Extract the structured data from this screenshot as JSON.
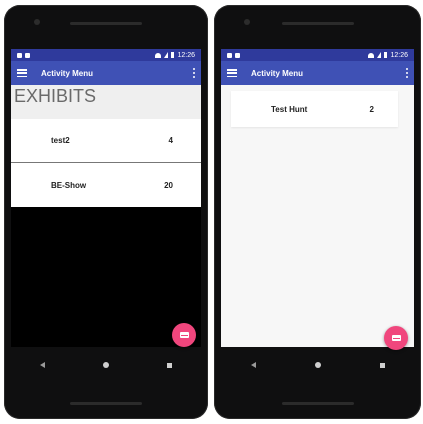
{
  "status": {
    "time": "12:26"
  },
  "left": {
    "appbar_title": "Activity Menu",
    "section_title": "EXHIBITS",
    "rows": [
      {
        "name": "test2",
        "count": "4"
      },
      {
        "name": "BE-Show",
        "count": "20"
      }
    ]
  },
  "right": {
    "appbar_title": "Activity Menu",
    "rows": [
      {
        "name": "Test Hunt",
        "count": "2"
      }
    ]
  },
  "icons": {
    "menu": "hamburger-icon",
    "overflow": "overflow-menu-icon",
    "fab": "mail-icon",
    "nav_back": "back-icon",
    "nav_home": "home-icon",
    "nav_recent": "recent-apps-icon"
  },
  "colors": {
    "appbar": "#3f51b5",
    "statusbar": "#2f3a9c",
    "fab": "#f0467d"
  }
}
